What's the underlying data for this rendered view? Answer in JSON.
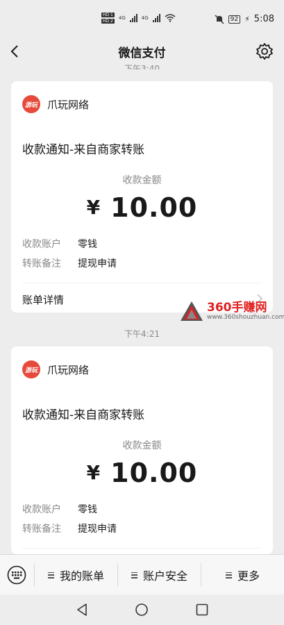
{
  "status_bar": {
    "hd1": "HD 1",
    "hd2": "HD 2",
    "net1": "4G",
    "net2": "4G",
    "battery": "92",
    "time": "5:08"
  },
  "nav": {
    "title": "微信支付",
    "back_icon": "back-arrow-icon",
    "settings_icon": "gear-icon"
  },
  "messages": [
    {
      "time": "下午3:40",
      "merchant": "爪玩网络",
      "logo_text": "游玩",
      "title": "收款通知-来自商家转账",
      "amount_label": "收款金额",
      "currency": "¥",
      "amount": "10.00",
      "account_label": "收款账户",
      "account_value": "零钱",
      "note_label": "转账备注",
      "note_value": "提现申请",
      "detail_label": "账单详情"
    },
    {
      "time": "下午4:21",
      "merchant": "爪玩网络",
      "logo_text": "游玩",
      "title": "收款通知-来自商家转账",
      "amount_label": "收款金额",
      "currency": "¥",
      "amount": "10.00",
      "account_label": "收款账户",
      "account_value": "零钱",
      "note_label": "转账备注",
      "note_value": "提现申请"
    }
  ],
  "watermark": {
    "main": "360手赚网",
    "url": "www.360shouzhuan.com"
  },
  "tabbar": {
    "tabs": [
      {
        "label": "我的账单"
      },
      {
        "label": "账户安全"
      },
      {
        "label": "更多"
      }
    ],
    "keyboard_icon": "keyboard-icon"
  },
  "colors": {
    "background": "#ededed",
    "card": "#ffffff",
    "logo": "#e64a3b",
    "watermark": "#e02020"
  }
}
